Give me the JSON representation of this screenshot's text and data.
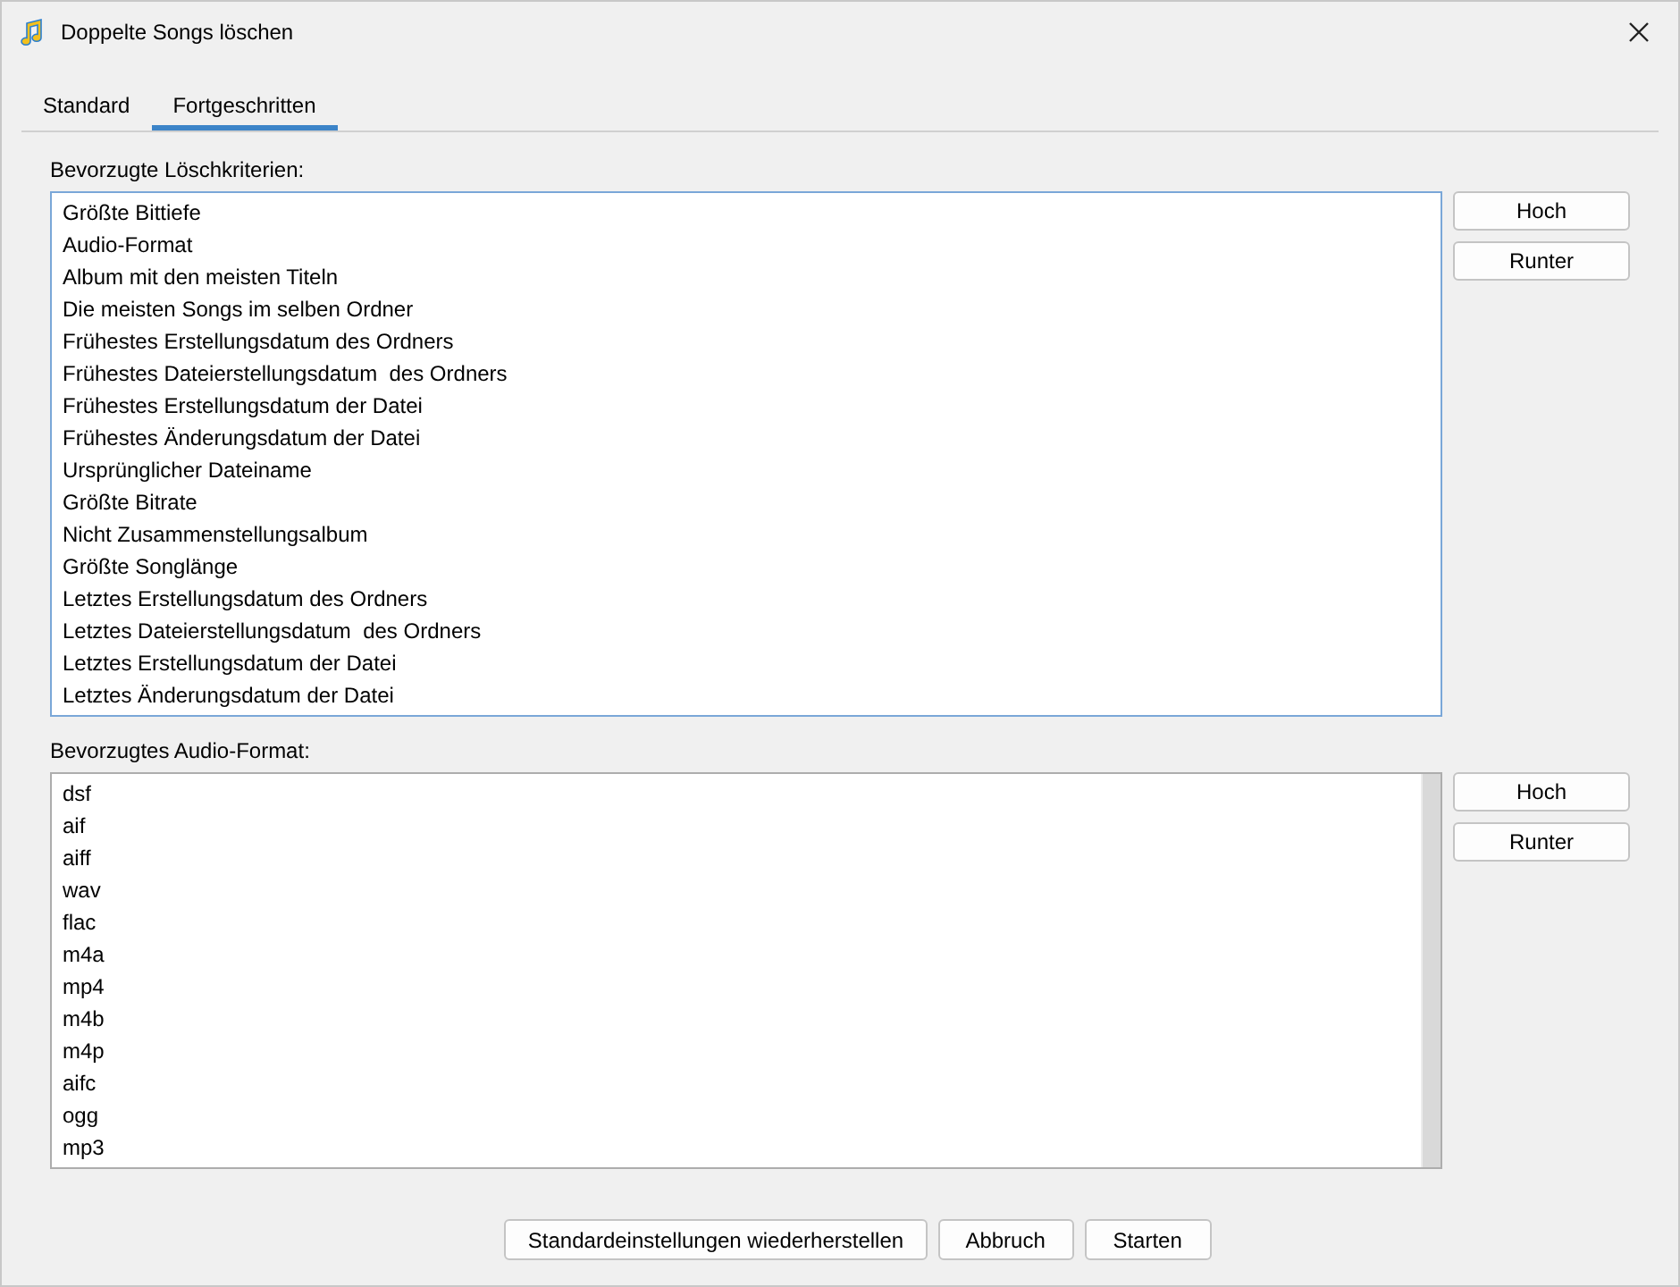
{
  "window": {
    "title": "Doppelte Songs löschen"
  },
  "tabs": [
    {
      "label": "Standard",
      "selected": false
    },
    {
      "label": "Fortgeschritten",
      "selected": true
    }
  ],
  "lists": [
    {
      "label": "Bevorzugte Löschkriterien:",
      "focused": true,
      "items": [
        "Größte Bittiefe",
        "Audio-Format",
        "Album mit den meisten Titeln",
        "Die meisten Songs im selben Ordner",
        "Frühestes Erstellungsdatum des Ordners",
        "Frühestes Dateierstellungsdatum  des Ordners",
        "Frühestes Erstellungsdatum der Datei",
        "Frühestes Änderungsdatum der Datei",
        "Ursprünglicher Dateiname",
        "Größte Bitrate",
        "Nicht Zusammenstellungsalbum",
        "Größte Songlänge",
        "Letztes Erstellungsdatum des Ordners",
        "Letztes Dateierstellungsdatum  des Ordners",
        "Letztes Erstellungsdatum der Datei",
        "Letztes Änderungsdatum der Datei"
      ],
      "buttons": [
        "Hoch",
        "Runter"
      ]
    },
    {
      "label": "Bevorzugtes Audio-Format:",
      "focused": false,
      "scrollbar": true,
      "items": [
        "dsf",
        "aif",
        "aiff",
        "wav",
        "flac",
        "m4a",
        "mp4",
        "m4b",
        "m4p",
        "aifc",
        "ogg",
        "mp3"
      ],
      "buttons": [
        "Hoch",
        "Runter"
      ]
    }
  ],
  "footer_buttons": [
    "Standardeinstellungen wiederherstellen",
    "Abbruch",
    "Starten"
  ]
}
